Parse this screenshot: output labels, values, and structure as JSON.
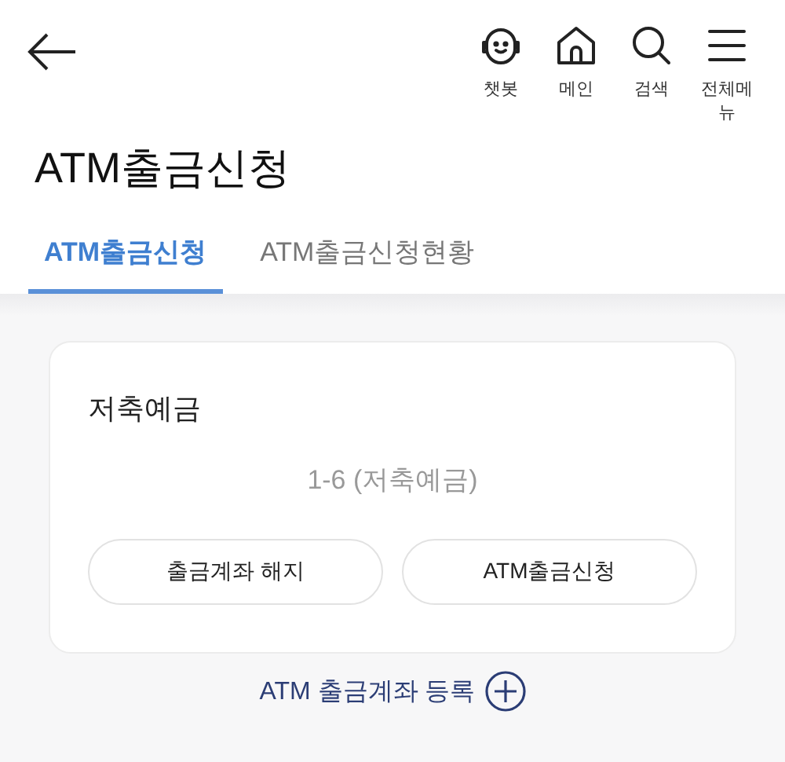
{
  "header": {
    "nav": [
      {
        "kind": "chatbot",
        "label": "챗봇"
      },
      {
        "kind": "home",
        "label": "메인"
      },
      {
        "kind": "search",
        "label": "검색"
      },
      {
        "kind": "menu",
        "label": "전체메뉴"
      }
    ]
  },
  "title": "ATM출금신청",
  "tabs": [
    {
      "label": "ATM출금신청",
      "selected": true
    },
    {
      "label": "ATM출금신청현황",
      "selected": false
    }
  ],
  "card": {
    "title": "저축예금",
    "account": "1-6 (저축예금)",
    "buttons": [
      "출금계좌 해지",
      "ATM출금신청"
    ]
  },
  "register_link": "ATM 출금계좌 등록"
}
